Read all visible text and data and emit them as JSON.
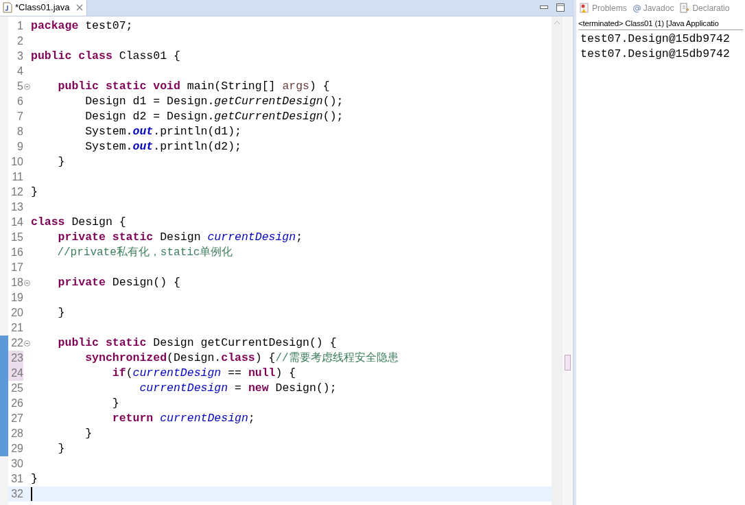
{
  "editor": {
    "tab": {
      "title": "*Class01.java",
      "selected": true
    },
    "lines": [
      {
        "number": "1",
        "tokens": [
          {
            "text": "package",
            "kind": "keyword"
          },
          {
            "text": " test07;",
            "kind": "plain"
          }
        ]
      },
      {
        "number": "2"
      },
      {
        "number": "3",
        "tokens": [
          {
            "text": "public class",
            "kind": "keyword"
          },
          {
            "text": " Class01 {",
            "kind": "plain"
          }
        ]
      },
      {
        "number": "4"
      },
      {
        "number": "5",
        "fold": true,
        "tokens": [
          {
            "text": "    public static void",
            "kind": "keyword"
          },
          {
            "text": " main(String[] ",
            "kind": "plain"
          },
          {
            "text": "args",
            "kind": "param"
          },
          {
            "text": ") {",
            "kind": "plain"
          }
        ]
      },
      {
        "number": "6",
        "tokens": [
          {
            "text": "        Design d1 = Design.",
            "kind": "plain"
          },
          {
            "text": "getCurrentDesign",
            "kind": "static_method"
          },
          {
            "text": "();",
            "kind": "plain"
          }
        ]
      },
      {
        "number": "7",
        "tokens": [
          {
            "text": "        Design d2 = Design.",
            "kind": "plain"
          },
          {
            "text": "getCurrentDesign",
            "kind": "static_method"
          },
          {
            "text": "();",
            "kind": "plain"
          }
        ]
      },
      {
        "number": "8",
        "tokens": [
          {
            "text": "        System.",
            "kind": "plain"
          },
          {
            "text": "out",
            "kind": "static_field"
          },
          {
            "text": ".println(d1);",
            "kind": "plain"
          }
        ]
      },
      {
        "number": "9",
        "tokens": [
          {
            "text": "        System.",
            "kind": "plain"
          },
          {
            "text": "out",
            "kind": "static_field"
          },
          {
            "text": ".println(d2);",
            "kind": "plain"
          }
        ]
      },
      {
        "number": "10",
        "tokens": [
          {
            "text": "    }",
            "kind": "plain"
          }
        ]
      },
      {
        "number": "11"
      },
      {
        "number": "12",
        "tokens": [
          {
            "text": "}",
            "kind": "plain"
          }
        ]
      },
      {
        "number": "13"
      },
      {
        "number": "14",
        "tokens": [
          {
            "text": "class",
            "kind": "keyword"
          },
          {
            "text": " Design {",
            "kind": "plain"
          }
        ]
      },
      {
        "number": "15",
        "tokens": [
          {
            "text": "    private static",
            "kind": "keyword"
          },
          {
            "text": " Design ",
            "kind": "plain"
          },
          {
            "text": "currentDesign",
            "kind": "field"
          },
          {
            "text": ";",
            "kind": "plain"
          }
        ]
      },
      {
        "number": "16",
        "tokens": [
          {
            "text": "    //private私有化，static单例化",
            "kind": "comment"
          }
        ]
      },
      {
        "number": "17"
      },
      {
        "number": "18",
        "fold": true,
        "tokens": [
          {
            "text": "    private",
            "kind": "keyword"
          },
          {
            "text": " Design() {",
            "kind": "plain"
          }
        ]
      },
      {
        "number": "19"
      },
      {
        "number": "20",
        "tokens": [
          {
            "text": "    }",
            "kind": "plain"
          }
        ]
      },
      {
        "number": "21"
      },
      {
        "number": "22",
        "fold": true,
        "changed": true,
        "tokens": [
          {
            "text": "    public static",
            "kind": "keyword"
          },
          {
            "text": " Design getCurrentDesign() {",
            "kind": "plain"
          }
        ]
      },
      {
        "number": "23",
        "changed": true,
        "highlighted": true,
        "tokens": [
          {
            "text": "        synchronized",
            "kind": "keyword"
          },
          {
            "text": "(Design.",
            "kind": "plain"
          },
          {
            "text": "class",
            "kind": "keyword"
          },
          {
            "text": ") {",
            "kind": "plain"
          },
          {
            "text": "//需要考虑线程安全隐患",
            "kind": "comment"
          }
        ]
      },
      {
        "number": "24",
        "changed": true,
        "highlighted": true,
        "tokens": [
          {
            "text": "            if",
            "kind": "keyword"
          },
          {
            "text": "(",
            "kind": "plain"
          },
          {
            "text": "currentDesign",
            "kind": "field"
          },
          {
            "text": " == ",
            "kind": "plain"
          },
          {
            "text": "null",
            "kind": "keyword"
          },
          {
            "text": ") {",
            "kind": "plain"
          }
        ]
      },
      {
        "number": "25",
        "changed": true,
        "tokens": [
          {
            "text": "                currentDesign",
            "kind": "field"
          },
          {
            "text": " = ",
            "kind": "plain"
          },
          {
            "text": "new",
            "kind": "keyword"
          },
          {
            "text": " Design();",
            "kind": "plain"
          }
        ]
      },
      {
        "number": "26",
        "changed": true,
        "tokens": [
          {
            "text": "            }",
            "kind": "plain"
          }
        ]
      },
      {
        "number": "27",
        "changed": true,
        "tokens": [
          {
            "text": "            return",
            "kind": "keyword"
          },
          {
            "text": " currentDesign",
            "kind": "field"
          },
          {
            "text": ";",
            "kind": "plain"
          }
        ]
      },
      {
        "number": "28",
        "changed": true,
        "tokens": [
          {
            "text": "        }",
            "kind": "plain"
          }
        ]
      },
      {
        "number": "29",
        "changed": true,
        "tokens": [
          {
            "text": "    }",
            "kind": "plain"
          }
        ]
      },
      {
        "number": "30"
      },
      {
        "number": "31",
        "tokens": [
          {
            "text": "}",
            "kind": "plain"
          }
        ]
      },
      {
        "number": "32",
        "current": true
      }
    ]
  },
  "console": {
    "tabs": [
      {
        "label": "Problems",
        "kind": "problems",
        "selected": false
      },
      {
        "label": "Javadoc",
        "kind": "javadoc",
        "selected": false
      },
      {
        "label": "Declaratio",
        "kind": "declaration",
        "selected": false
      }
    ],
    "status": "<terminated> Class01 (1) [Java Applicatio",
    "output": [
      "test07.Design@15db9742",
      "test07.Design@15db9742"
    ]
  }
}
